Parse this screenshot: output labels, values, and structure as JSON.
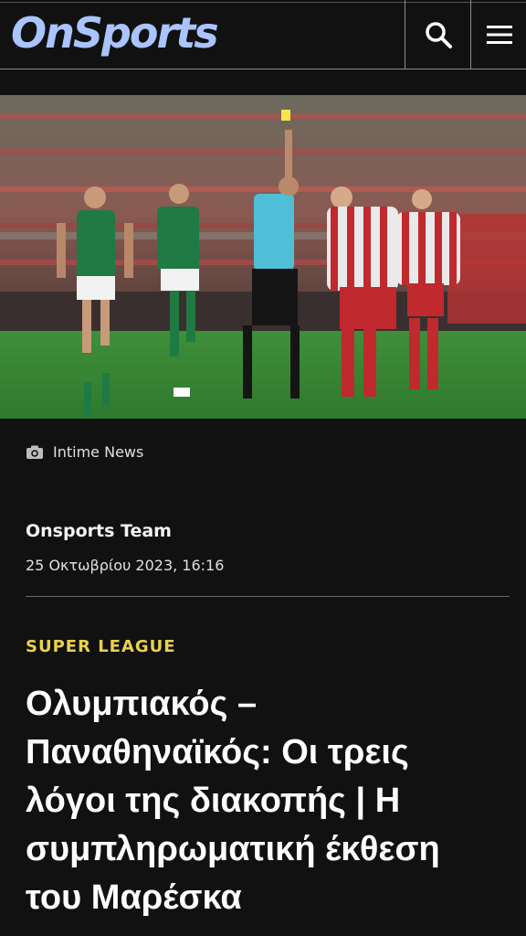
{
  "header": {
    "logo_text": "OnSports",
    "logo_color": "#a9c4ff",
    "search_icon": "search-icon",
    "menu_icon": "hamburger-menu-icon"
  },
  "hero": {
    "image_description_icon": "photo",
    "credit_icon": "camera-icon",
    "credit": "Intime News"
  },
  "article": {
    "author": "Onsports Team",
    "date": "25 Οκτωβρίου 2023, 16:16",
    "category": "SUPER LEAGUE",
    "category_color": "#e8d24a",
    "title": "Ολυμπιακός – Παναθηναϊκός: Οι τρεις λόγοι της διακοπής | Η συμπληρωματική έκθεση του Μαρέσκα"
  }
}
